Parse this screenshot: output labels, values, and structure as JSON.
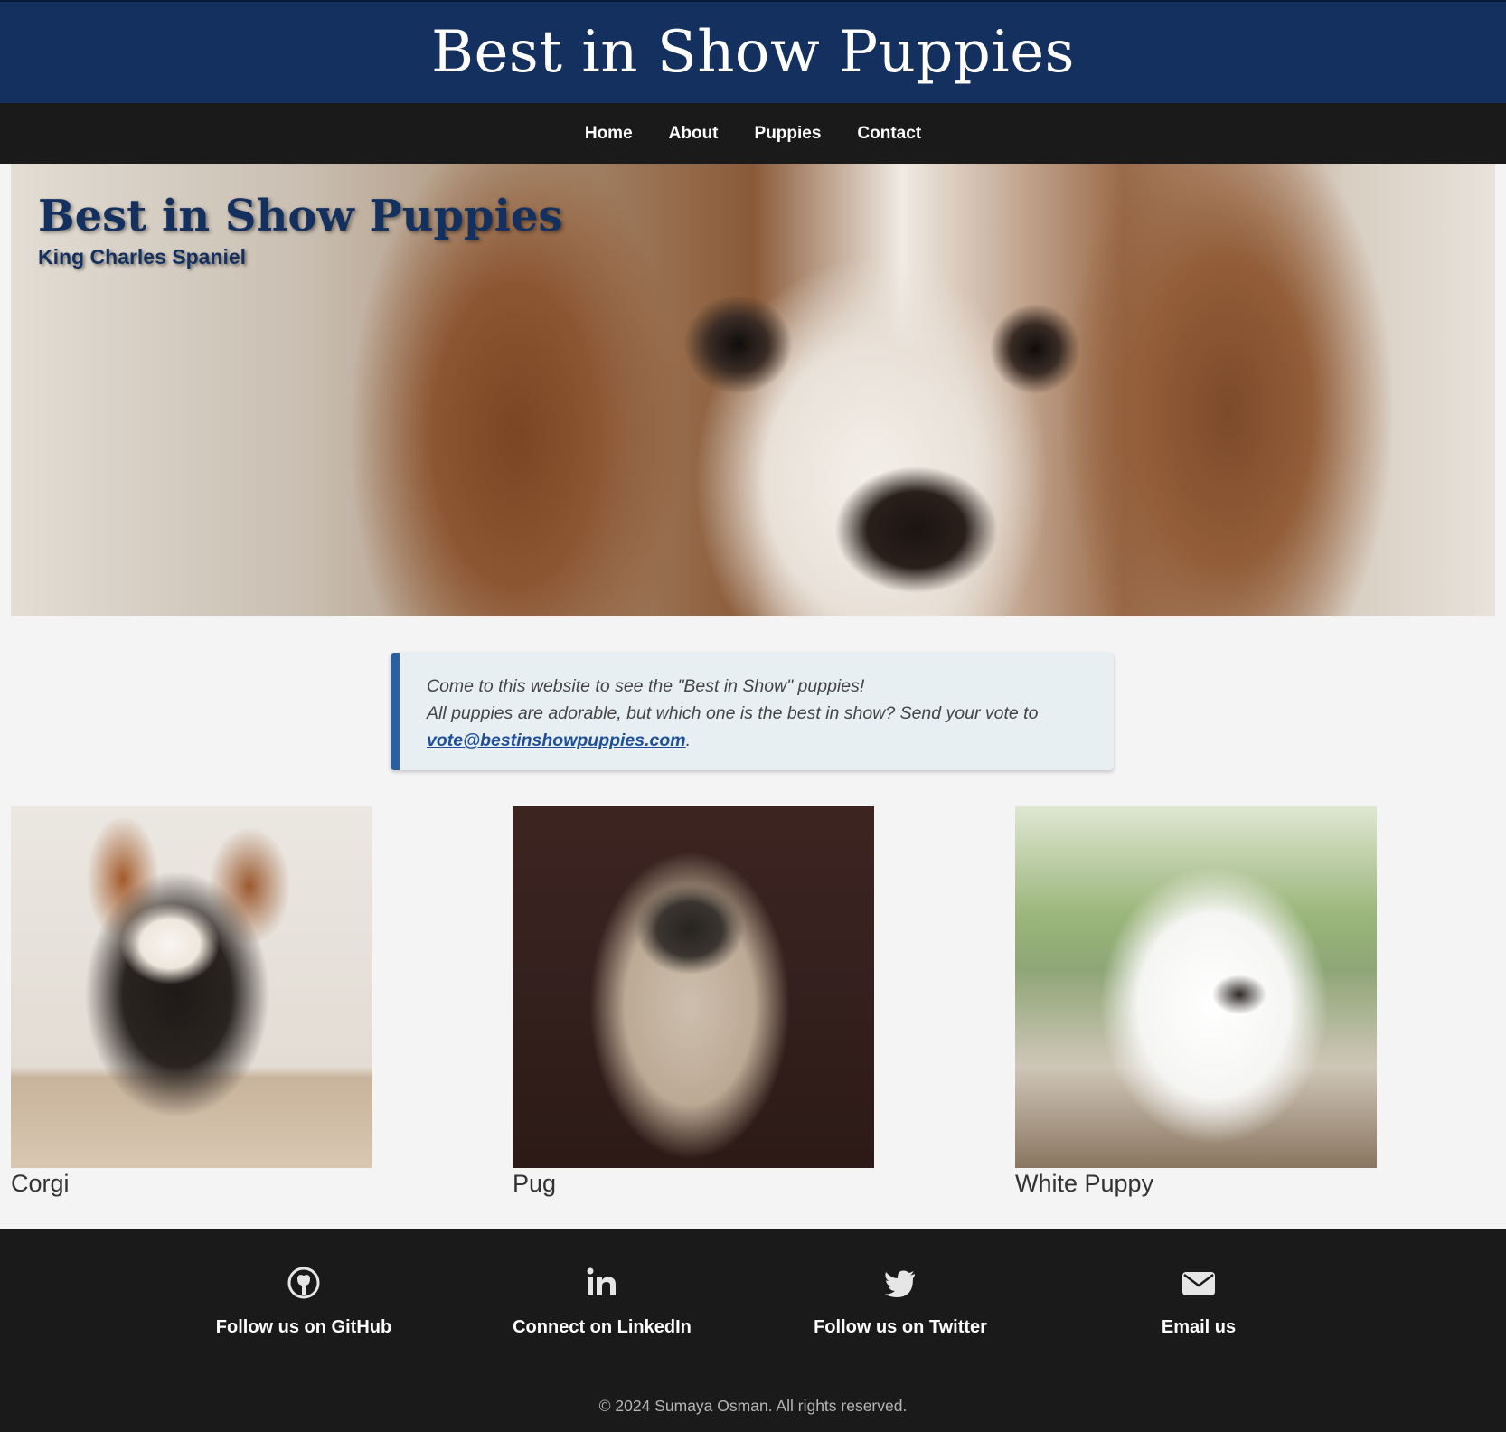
{
  "header": {
    "title": "Best in Show Puppies"
  },
  "nav": {
    "items": [
      {
        "label": "Home"
      },
      {
        "label": "About"
      },
      {
        "label": "Puppies"
      },
      {
        "label": "Contact"
      }
    ]
  },
  "hero": {
    "title": "Best in Show Puppies",
    "subtitle": "King Charles Spaniel"
  },
  "intro": {
    "line1": "Come to this website to see the \"Best in Show\" puppies!",
    "line2": "All puppies are adorable, but which one is the best in show? Send your vote to",
    "email": "vote@bestinshowpuppies.com",
    "after_email": "."
  },
  "gallery": {
    "items": [
      {
        "caption": "Corgi"
      },
      {
        "caption": "Pug"
      },
      {
        "caption": "White Puppy"
      }
    ]
  },
  "footer": {
    "links": [
      {
        "label": "Follow us on GitHub",
        "icon": "github-icon"
      },
      {
        "label": "Connect on LinkedIn",
        "icon": "linkedin-icon"
      },
      {
        "label": "Follow us on Twitter",
        "icon": "twitter-icon"
      },
      {
        "label": "Email us",
        "icon": "envelope-icon"
      }
    ],
    "copyright": "© 2024 Sumaya Osman. All rights reserved."
  },
  "colors": {
    "header_bg": "#14305f",
    "nav_bg": "#1a1a1a",
    "accent": "#2c5f9e",
    "intro_bg": "#e8eff3",
    "page_bg": "#f4f4f4"
  }
}
